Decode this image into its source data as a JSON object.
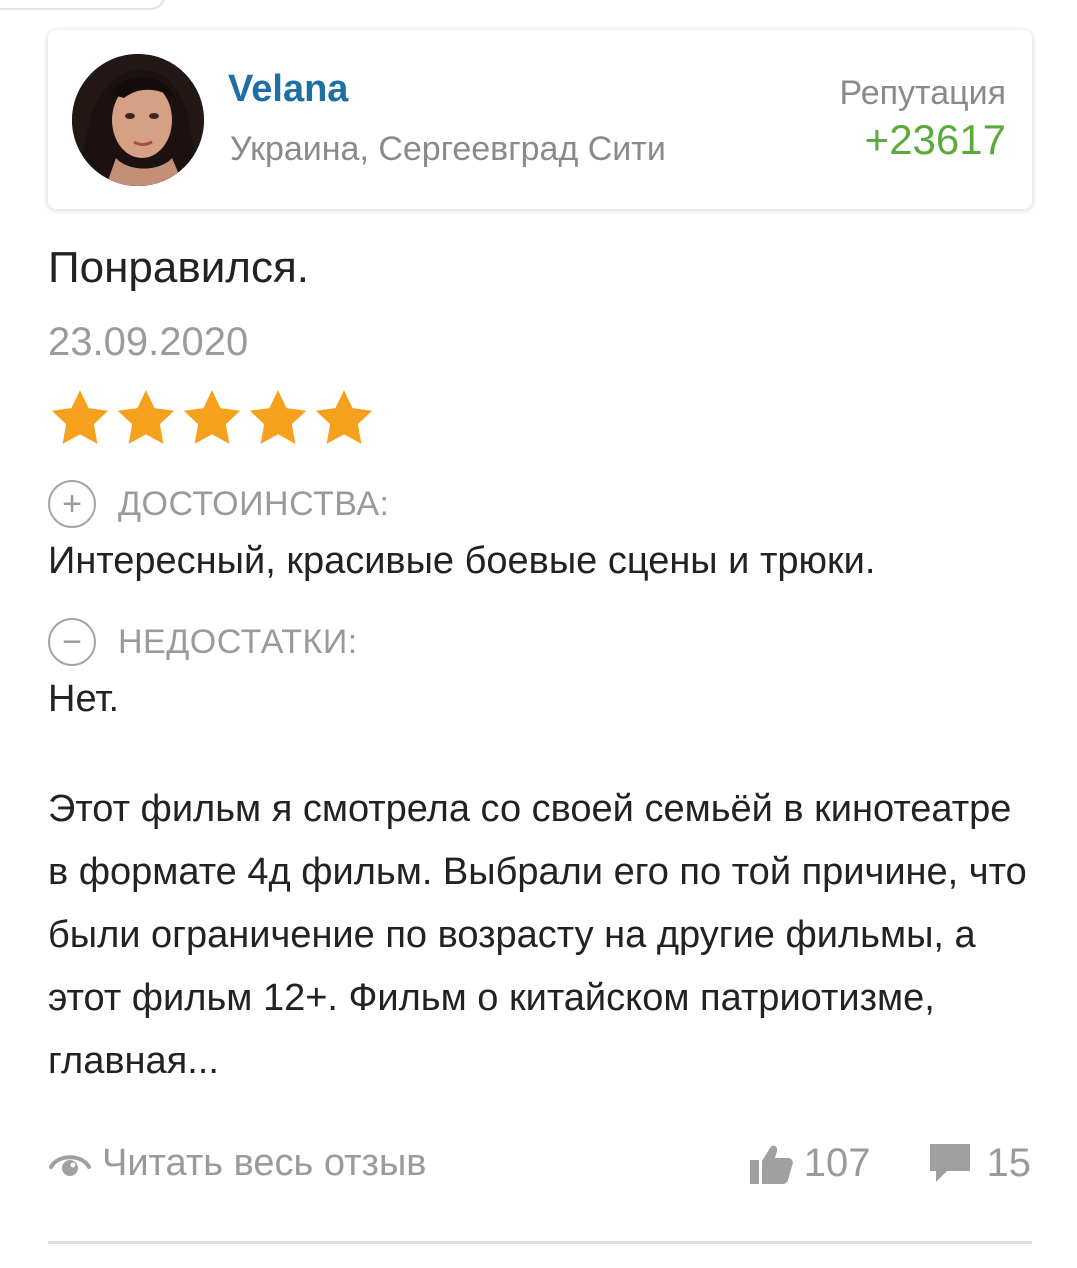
{
  "author": {
    "name": "Velana",
    "location": "Украина, Сергеевград Сити",
    "reputation_label": "Репутация",
    "reputation_value": "+23617"
  },
  "review": {
    "title": "Понравился.",
    "date": "23.09.2020",
    "rating": 5,
    "rating_max": 5,
    "pros_label": "ДОСТОИНСТВА:",
    "pros_text": "Интересный, красивые боевые сцены и трюки.",
    "cons_label": "НЕДОСТАТКИ:",
    "cons_text": "Нет.",
    "body": "Этот фильм я смотрела со своей семьёй в кинотеатре в формате 4д фильм. Выбрали его по той причине, что были ограничение по возрасту на другие фильмы, а этот фильм 12+. Фильм о китайском патриотизме, главная..."
  },
  "footer": {
    "read_full_label": "Читать весь отзыв",
    "likes": "107",
    "comments": "15"
  },
  "colors": {
    "author_name": "#1d6fa5",
    "reputation": "#5aab3b",
    "star": "#f5a11d",
    "muted": "#9a9a9a"
  },
  "icons": {
    "pros": "plus-circle-icon",
    "cons": "minus-circle-icon",
    "read": "eye-icon",
    "likes": "thumbs-up-icon",
    "comments": "comment-icon"
  }
}
